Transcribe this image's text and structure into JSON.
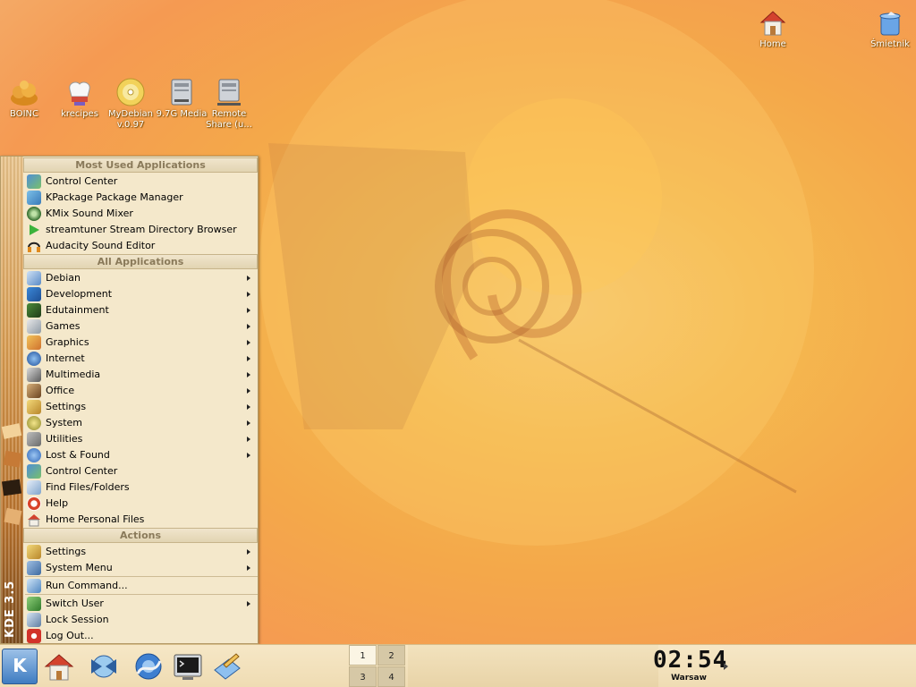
{
  "desktop": {
    "icons": [
      {
        "label": "BOINC"
      },
      {
        "label": "krecipes"
      },
      {
        "label": "MyDebian v.0.97"
      },
      {
        "label": "9.7G Media"
      },
      {
        "label": "Remote Share (u..."
      },
      {
        "label": "Home"
      },
      {
        "label": "Śmietnik"
      }
    ]
  },
  "kmenu": {
    "brand": "KDE 3.5",
    "sections": {
      "most_used": "Most Used Applications",
      "all": "All Applications",
      "actions": "Actions"
    },
    "most_used_items": [
      {
        "label": "Control Center",
        "icon": "control-center-icon"
      },
      {
        "label": "KPackage Package Manager",
        "icon": "package-icon"
      },
      {
        "label": "KMix Sound Mixer",
        "icon": "mixer-icon"
      },
      {
        "label": "streamtuner Stream Directory Browser",
        "icon": "play-icon"
      },
      {
        "label": "Audacity Sound Editor",
        "icon": "headphones-icon"
      }
    ],
    "all_items": [
      {
        "label": "Debian",
        "icon": "debian-icon",
        "submenu": true
      },
      {
        "label": "Development",
        "icon": "development-icon",
        "submenu": true
      },
      {
        "label": "Edutainment",
        "icon": "edutainment-icon",
        "submenu": true
      },
      {
        "label": "Games",
        "icon": "games-icon",
        "submenu": true
      },
      {
        "label": "Graphics",
        "icon": "graphics-icon",
        "submenu": true
      },
      {
        "label": "Internet",
        "icon": "internet-icon",
        "submenu": true
      },
      {
        "label": "Multimedia",
        "icon": "multimedia-icon",
        "submenu": true
      },
      {
        "label": "Office",
        "icon": "office-icon",
        "submenu": true
      },
      {
        "label": "Settings",
        "icon": "settings-icon",
        "submenu": true
      },
      {
        "label": "System",
        "icon": "system-icon",
        "submenu": true
      },
      {
        "label": "Utilities",
        "icon": "utilities-icon",
        "submenu": true
      },
      {
        "label": "Lost & Found",
        "icon": "lost-found-icon",
        "submenu": true
      },
      {
        "label": "Control Center",
        "icon": "control-center-icon",
        "submenu": false
      },
      {
        "label": "Find Files/Folders",
        "icon": "find-icon",
        "submenu": false
      },
      {
        "label": "Help",
        "icon": "help-icon",
        "submenu": false
      },
      {
        "label": "Home Personal Files",
        "icon": "home-icon",
        "submenu": false
      }
    ],
    "actions_items": [
      {
        "label": "Settings",
        "icon": "settings-icon",
        "submenu": true
      },
      {
        "label": "System Menu",
        "icon": "system-menu-icon",
        "submenu": true
      },
      {
        "label": "Run Command...",
        "icon": "run-icon",
        "submenu": false
      },
      {
        "label": "Switch User",
        "icon": "switch-user-icon",
        "submenu": true
      },
      {
        "label": "Lock Session",
        "icon": "lock-icon",
        "submenu": false
      },
      {
        "label": "Log Out...",
        "icon": "logout-icon",
        "submenu": false
      }
    ]
  },
  "taskbar": {
    "pager": [
      "1",
      "2",
      "3",
      "4"
    ],
    "active_desktop": "1",
    "clock_time": "02:54",
    "clock_city": "Warsaw"
  }
}
